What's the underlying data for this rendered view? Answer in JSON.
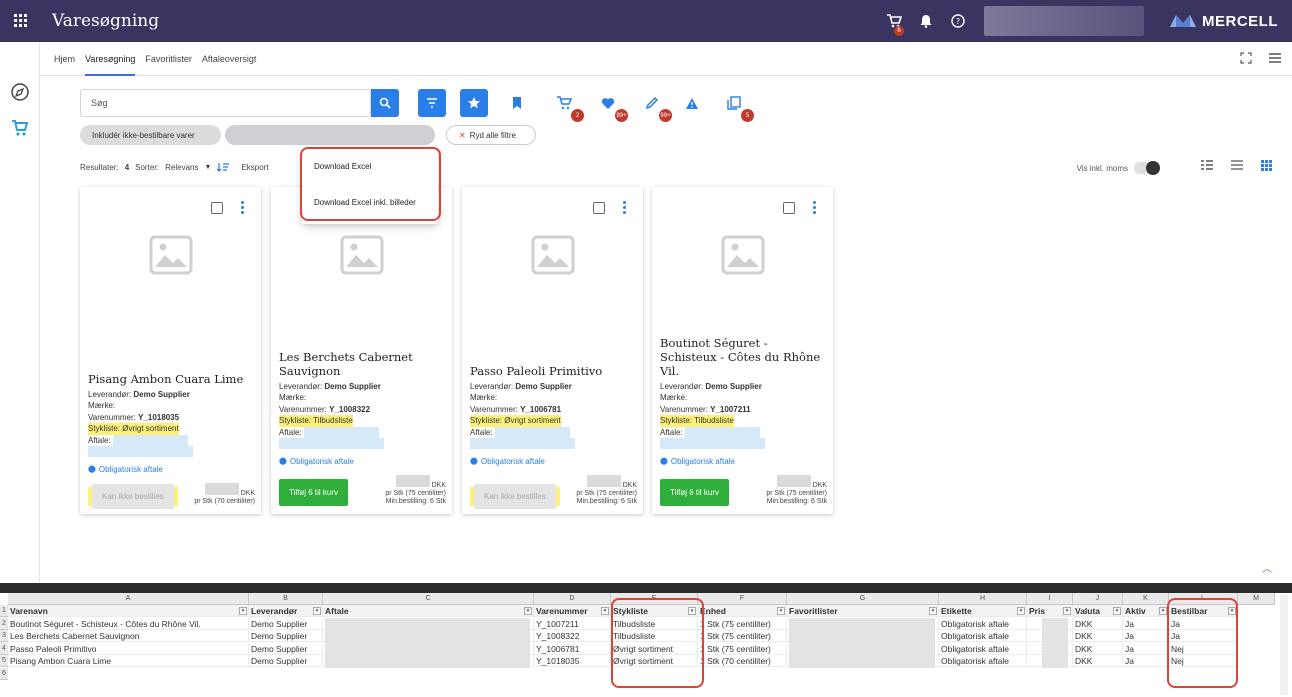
{
  "app": {
    "title": "Varesøgning",
    "brand": "MERCELL",
    "accent": "#2a7ee8",
    "topbar_color": "#3a3560"
  },
  "topbar": {
    "cart_badge": "6"
  },
  "nav": {
    "items": [
      "Hjem",
      "Varesøgning",
      "Favoritlister",
      "Aftaleoversigt"
    ]
  },
  "search": {
    "placeholder": "Søg"
  },
  "toolbar_badges": {
    "cart": "2",
    "heart": "99+",
    "pen": "99+",
    "list": "5"
  },
  "chips": {
    "include": "Inkludér ikke-bestilbare varer",
    "clear": "Ryd alle filtre"
  },
  "results": {
    "label": "Resultater:",
    "count": "4",
    "sort_label": "Sorter:",
    "sort_value": "Relevans",
    "export": "Eksport",
    "vis_moms": "Vis inkl. moms"
  },
  "dropdown": {
    "items": [
      "Download Excel",
      "Download Excel inkl. billeder"
    ]
  },
  "cards": [
    {
      "title": "Pisang Ambon Cuara Lime",
      "leverandor_label": "Leverandør:",
      "leverandor": "Demo Supplier",
      "maerke": "Mærke:",
      "varenummer_label": "Varenummer:",
      "varenummer": "Y_1018035",
      "stykliste": "Stykliste: Øvrigt sortiment",
      "aftale": "Aftale:",
      "oblig": "Obligatorisk aftale",
      "button": "Kan ikke bestilles",
      "currency": "DKK",
      "unit": "pr Stk (70 centiliter)",
      "min": ""
    },
    {
      "title": "Les Berchets Cabernet Sauvignon",
      "leverandor_label": "Leverandør:",
      "leverandor": "Demo Supplier",
      "maerke": "Mærke:",
      "varenummer_label": "Varenummer:",
      "varenummer": "Y_1008322",
      "stykliste": "Stykliste: Tilbudsliste",
      "aftale": "Aftale:",
      "oblig": "Obligatorisk aftale",
      "button": "Tilføj 6 til kurv",
      "currency": "DKK",
      "unit": "pr Stk (75 centiliter)",
      "min": "Min.bestilling: 6 Stk"
    },
    {
      "title": "Passo Paleoli Primitivo",
      "leverandor_label": "Leverandør:",
      "leverandor": "Demo Supplier",
      "maerke": "Mærke:",
      "varenummer_label": "Varenummer:",
      "varenummer": "Y_1006781",
      "stykliste": "Stykliste: Øvrigt sortiment",
      "aftale": "Aftale:",
      "oblig": "Obligatorisk aftale",
      "button": "Kan ikke bestilles",
      "currency": "DKK",
      "unit": "pr Stk (75 centiliter)",
      "min": "Min.bestilling: 6 Stk"
    },
    {
      "title": "Boutinot Séguret - Schisteux - Côtes du Rhône Vil.",
      "leverandor_label": "Leverandør:",
      "leverandor": "Demo Supplier",
      "maerke": "Mærke:",
      "varenummer_label": "Varenummer:",
      "varenummer": "Y_1007211",
      "stykliste": "Stykliste: Tilbudsliste",
      "aftale": "Aftale:",
      "oblig": "Obligatorisk aftale",
      "button": "Tilføj 6 til kurv",
      "currency": "DKK",
      "unit": "pr Stk (75 centiliter)",
      "min": "Min.bestilling: 6 Stk"
    }
  ],
  "sheet": {
    "columns": [
      "A",
      "B",
      "C",
      "D",
      "E",
      "F",
      "G",
      "H",
      "I",
      "J",
      "K",
      "L",
      "M"
    ],
    "headers": [
      "Varenavn",
      "Leverandør",
      "Aftale",
      "Varenummer",
      "Stykliste",
      "Enhed",
      "Favoritlister",
      "Etikette",
      "Pris",
      "Valuta",
      "Aktiv",
      "Bestilbar"
    ],
    "rows": [
      [
        "Boutinot Séguret - Schisteux - Côtes du Rhône Vil.",
        "Demo Supplier",
        "",
        "Y_1007211",
        "Tilbudsliste",
        "1 Stk (75 centiliter)",
        "",
        "Obligatorisk aftale",
        "",
        "DKK",
        "Ja",
        "Ja"
      ],
      [
        "Les Berchets Cabernet Sauvignon",
        "Demo Supplier",
        "",
        "Y_1008322",
        "Tilbudsliste",
        "1 Stk (75 centiliter)",
        "",
        "Obligatorisk aftale",
        "",
        "DKK",
        "Ja",
        "Ja"
      ],
      [
        "Passo Paleoli  Primitivo",
        "Demo Supplier",
        "",
        "Y_1006781",
        "Øvrigt sortiment",
        "1 Stk (75 centiliter)",
        "",
        "Obligatorisk aftale",
        "",
        "DKK",
        "Ja",
        "Nej"
      ],
      [
        "Pisang Ambon Cuara Lime",
        "Demo Supplier",
        "",
        "Y_1018035",
        "Øvrigt sortiment",
        "1 Stk (70 centiliter)",
        "",
        "Obligatorisk aftale",
        "",
        "DKK",
        "Ja",
        "Nej"
      ]
    ],
    "row_numbers": [
      "1",
      "2",
      "3",
      "4",
      "5",
      "6"
    ]
  }
}
